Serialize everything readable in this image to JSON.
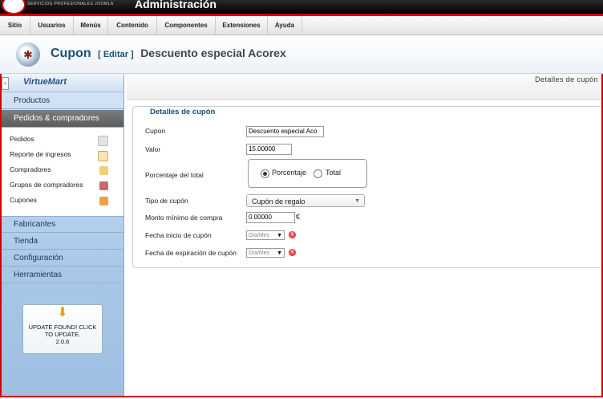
{
  "topbar": {
    "brand_sub": "SERVICIOS PROFESIONALES JOOMLA",
    "title": "Administración"
  },
  "menu": [
    "Sitio",
    "Usuarios",
    "Menús",
    "Contenido",
    "Componentes",
    "Extensiones",
    "Ayuda"
  ],
  "header": {
    "title": "Cupon",
    "edit": "[ Editar ]",
    "name": "Descuento especial Acorex"
  },
  "sidebar": {
    "logo": "VirtueMart",
    "sections": [
      "Productos",
      "Pedidos & compradores",
      "Fabricantes",
      "Tienda",
      "Configuración",
      "Herramientas"
    ],
    "active_section": "Pedidos & compradores",
    "subitems": [
      "Pedidos",
      "Reporte de ingresos",
      "Compradores",
      "Grupos de compradores",
      "Cupones"
    ],
    "update": {
      "text": "UPDATE FOUND! CLICK TO UPDATE.",
      "version": "2.0.6"
    }
  },
  "panel_tab": "Detalles de cupón",
  "form": {
    "legend": "Detalles de cupón",
    "labels": {
      "cupon": "Cupon",
      "valor": "Valor",
      "porcentaje": "Porcentaje del total",
      "tipo": "Tipo de cupón",
      "monto": "Monto mínimo de compra",
      "fecha_inicio": "Fecha inicio de cupón",
      "fecha_exp": "Fecha de expiración de cupón"
    },
    "cupon_value": "Descuento especial Aco",
    "valor_value": "15.00000",
    "radio_options": [
      "Porcentaje",
      "Total"
    ],
    "radio_selected": "Porcentaje",
    "tipo_value": "Cupón de regalo",
    "monto_value": "0.00000",
    "currency": "€",
    "date_placeholder": "Día/Mes"
  }
}
